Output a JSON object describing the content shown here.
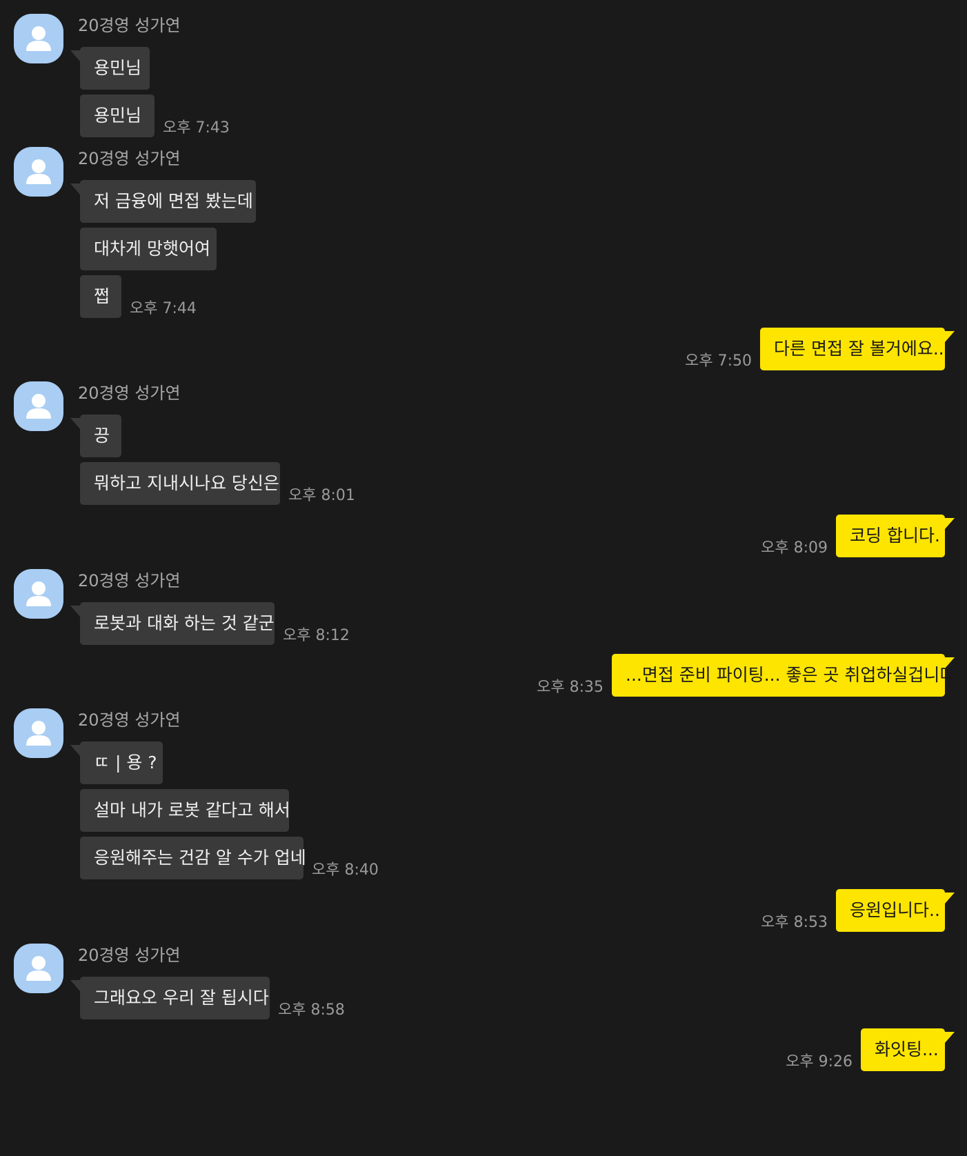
{
  "colors": {
    "background": "#1a1a1a",
    "received_bubble": "#3a3a3a",
    "sent_bubble": "#fee500",
    "avatar": "#a9cdf3",
    "avatar_glyph": "#ffffff"
  },
  "icons": {
    "avatar": "default-profile-person-icon"
  },
  "conversation": [
    {
      "direction": "received",
      "sender": "20경영 성가연",
      "messages": [
        {
          "text": "용민님"
        },
        {
          "text": "용민님",
          "time": "오후 7:43"
        }
      ]
    },
    {
      "direction": "received",
      "sender": "20경영 성가연",
      "messages": [
        {
          "text": "저 금융에 면접 봤는데"
        },
        {
          "text": "대차게 망햇어여"
        },
        {
          "text": "쩝",
          "time": "오후 7:44"
        }
      ]
    },
    {
      "direction": "sent",
      "messages": [
        {
          "text": "다른 면접 잘 볼거에요...",
          "time": "오후 7:50"
        }
      ]
    },
    {
      "direction": "received",
      "sender": "20경영 성가연",
      "messages": [
        {
          "text": "끙"
        },
        {
          "text": "뭐하고 지내시나요 당신은",
          "time": "오후 8:01"
        }
      ]
    },
    {
      "direction": "sent",
      "messages": [
        {
          "text": "코딩 합니다.",
          "time": "오후 8:09"
        }
      ]
    },
    {
      "direction": "received",
      "sender": "20경영 성가연",
      "messages": [
        {
          "text": "로봇과 대화 하는 것 같군",
          "time": "오후 8:12"
        }
      ]
    },
    {
      "direction": "sent",
      "messages": [
        {
          "text": "...면접 준비 파이팅... 좋은 곳 취업하실겁니다..",
          "time": "오후 8:35"
        }
      ]
    },
    {
      "direction": "received",
      "sender": "20경영 성가연",
      "messages": [
        {
          "text": "ㄸ | 용 ?"
        },
        {
          "text": "설마 내가 로봇 같다고 해서"
        },
        {
          "text": "응원해주는 건감 알 수가 업네",
          "time": "오후 8:40"
        }
      ]
    },
    {
      "direction": "sent",
      "messages": [
        {
          "text": "응원입니다..",
          "time": "오후 8:53"
        }
      ]
    },
    {
      "direction": "received",
      "sender": "20경영 성가연",
      "messages": [
        {
          "text": "그래요오 우리 잘 됩시다",
          "time": "오후 8:58"
        }
      ]
    },
    {
      "direction": "sent",
      "messages": [
        {
          "text": "화잇팅...",
          "time": "오후 9:26"
        }
      ]
    }
  ]
}
